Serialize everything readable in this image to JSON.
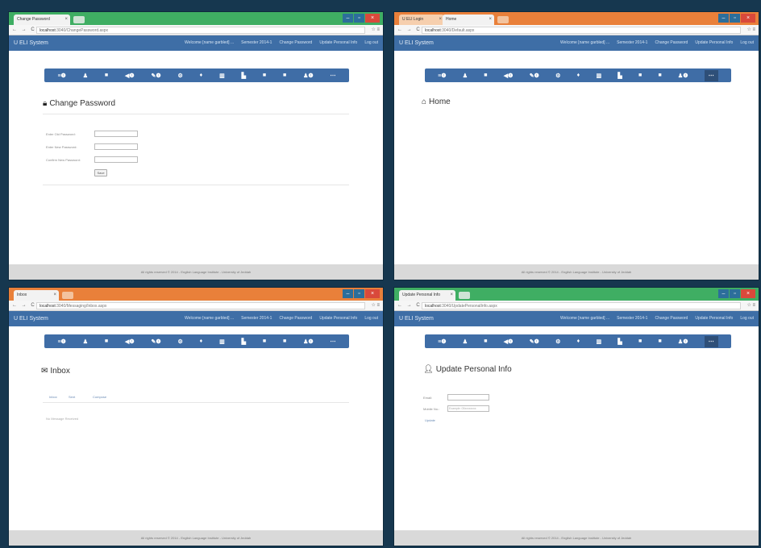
{
  "common": {
    "brand": "U ELI System",
    "nav_items": [
      "Welcome [name garbled] ...",
      "Semester 2014-1",
      "Change Password",
      "Update Personal Info",
      "Log out"
    ],
    "icon_labels": [
      "≡❶",
      "♟",
      "■",
      "◀❶",
      "✎❶",
      "⚙",
      "♦",
      "▥",
      "▙",
      "■",
      "■",
      "♟❶",
      "⋯"
    ],
    "url_host": "localhost"
  },
  "w1": {
    "tab_title": "Change Password",
    "url_path": ":3040/ChangePassword.aspx",
    "heading": "Change Password",
    "heading_icon": "lock-icon",
    "fields": [
      {
        "label": "Enter Old Password:"
      },
      {
        "label": "Enter New Password:"
      },
      {
        "label": "Confirm New Password:"
      }
    ],
    "button": "Save",
    "footer": "All rights reserved © 2014 - English Language Institute - University of Jeddah"
  },
  "w2": {
    "tab1": "U ELI Login",
    "tab2": "Home",
    "url_path": ":3040/Default.aspx",
    "heading": "Home",
    "heading_icon": "home-icon",
    "footer": "All rights reserved © 2014 - English Language Institute - University of Jeddah"
  },
  "w3": {
    "tab_title": "Inbox",
    "url_path": ":3040/Messaging/Inbox.aspx",
    "heading": "Inbox",
    "heading_icon": "envelope-icon",
    "subtabs": [
      "Inbox",
      "Sent",
      "Compose"
    ],
    "empty_text": "No Message Received",
    "footer": "All rights reserved © 2014 - English Language Institute - University of Jeddah"
  },
  "w4": {
    "tab_title": "Update Personal Info",
    "url_path": ":3040/UpdatePersonalInfo.aspx",
    "heading": "Update Personal Info",
    "heading_icon": "user-icon",
    "fields": [
      {
        "label": "Email:",
        "placeholder": ""
      },
      {
        "label": "Mobile No.:",
        "placeholder": "Example: 05xxxxxxxx"
      }
    ],
    "button": "Update",
    "footer": "All rights reserved © 2014 - English Language Institute - University of Jeddah"
  },
  "colors": {
    "accent": "#3e6ea6",
    "titlebar_green": "#3fae63",
    "titlebar_orange": "#e9803a",
    "desktop": "#16374f"
  }
}
